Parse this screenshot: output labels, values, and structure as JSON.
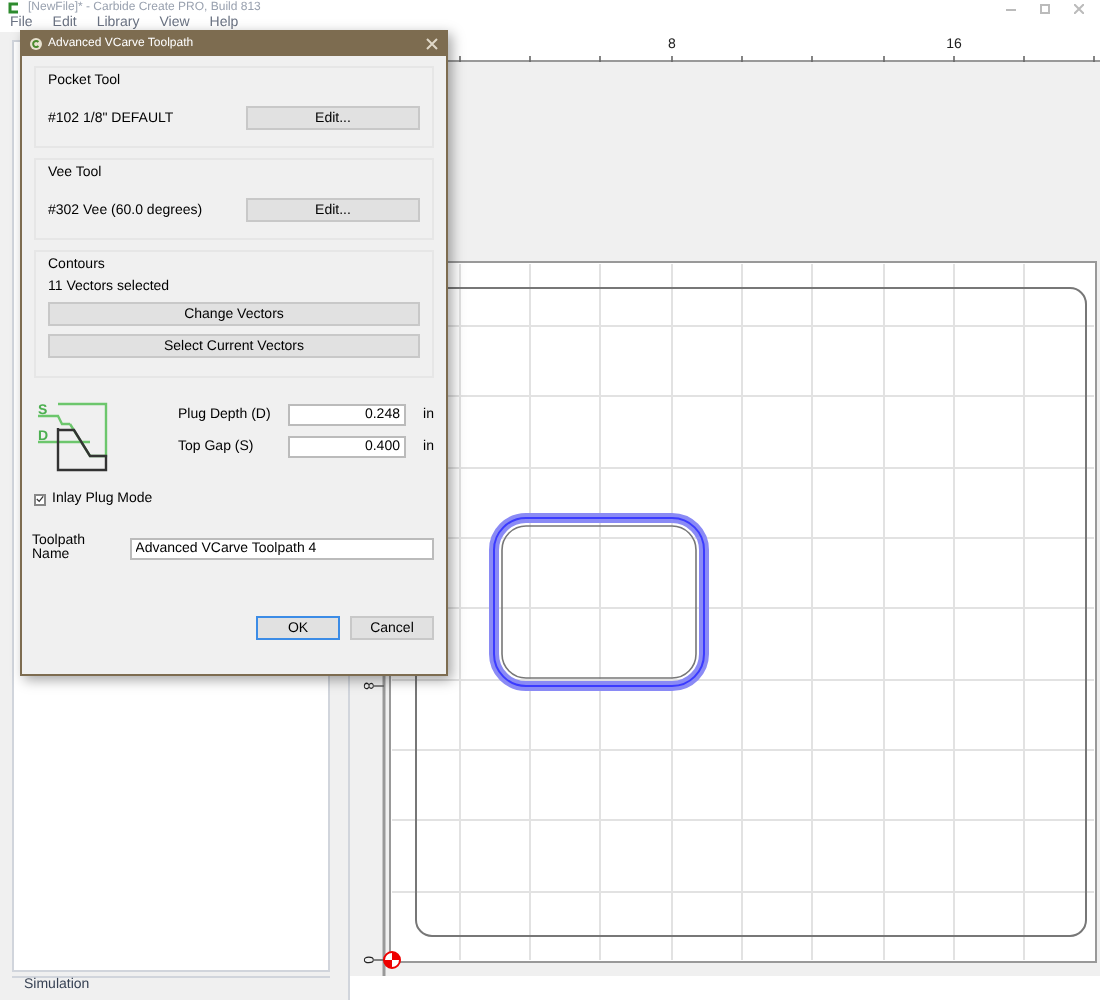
{
  "app": {
    "title": "[NewFile]* - Carbide Create PRO, Build 813",
    "menu": [
      "File",
      "Edit",
      "Library",
      "View",
      "Help"
    ]
  },
  "ruler": {
    "top_labels": [
      "8",
      "16"
    ],
    "left_labels": [
      "8",
      "0"
    ]
  },
  "left_panel": {
    "section": "Simulation"
  },
  "dialog": {
    "title": "Advanced VCarve Toolpath",
    "tools": [
      {
        "heading": "Pocket Tool",
        "tool": "#102 1/8\" DEFAULT",
        "button": "Edit..."
      },
      {
        "heading": "Vee Tool",
        "tool": "#302 Vee (60.0 degrees)",
        "button": "Edit..."
      }
    ],
    "contours": {
      "heading": "Contours",
      "status": "11 Vectors selected",
      "buttons": [
        "Change Vectors",
        "Select Current Vectors"
      ]
    },
    "diagram_labels": [
      "S",
      "D"
    ],
    "fields": [
      {
        "label": "Plug Depth (D)",
        "value": "0.248",
        "unit": "in"
      },
      {
        "label": "Top Gap (S)",
        "value": "0.400",
        "unit": "in"
      }
    ],
    "inlay": {
      "label": "Inlay Plug Mode",
      "checked": true
    },
    "toolpath_name": {
      "label": "Toolpath Name",
      "value": "Advanced VCarve Toolpath 4"
    },
    "buttons": [
      {
        "label": "OK",
        "default": true
      },
      {
        "label": "Cancel",
        "default": false
      }
    ]
  }
}
